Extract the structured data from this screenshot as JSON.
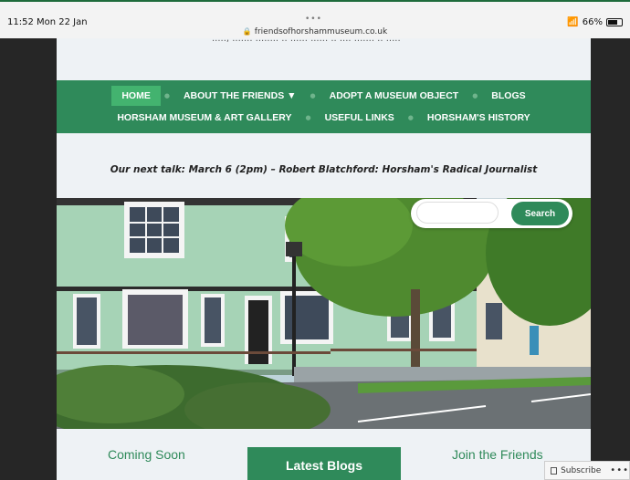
{
  "status_bar": {
    "time_date": "11:52  Mon 22 Jan",
    "url": "friendsofhorshammuseum.co.uk",
    "battery": "66%"
  },
  "nav": {
    "row1": [
      {
        "label": "HOME",
        "active": true
      },
      {
        "label": "ABOUT THE FRIENDS ▼",
        "active": false
      },
      {
        "label": "ADOPT A MUSEUM OBJECT",
        "active": false
      },
      {
        "label": "BLOGS",
        "active": false
      }
    ],
    "row2": [
      {
        "label": "HORSHAM MUSEUM & ART GALLERY",
        "active": false
      },
      {
        "label": "USEFUL LINKS",
        "active": false
      },
      {
        "label": "HORSHAM'S HISTORY",
        "active": false
      }
    ]
  },
  "announcement": "Our next talk: March 6 (2pm) – Robert Blatchford: Horsham's Radical Journalist",
  "search": {
    "placeholder": "",
    "button_label": "Search"
  },
  "sections": {
    "coming_soon": "Coming Soon",
    "latest_blogs": "Latest Blogs",
    "join": "Join the Friends"
  },
  "subscribe": {
    "label": "Subscribe"
  },
  "colors": {
    "brand_green": "#2f8a5a",
    "active_tab": "#43b36f"
  }
}
